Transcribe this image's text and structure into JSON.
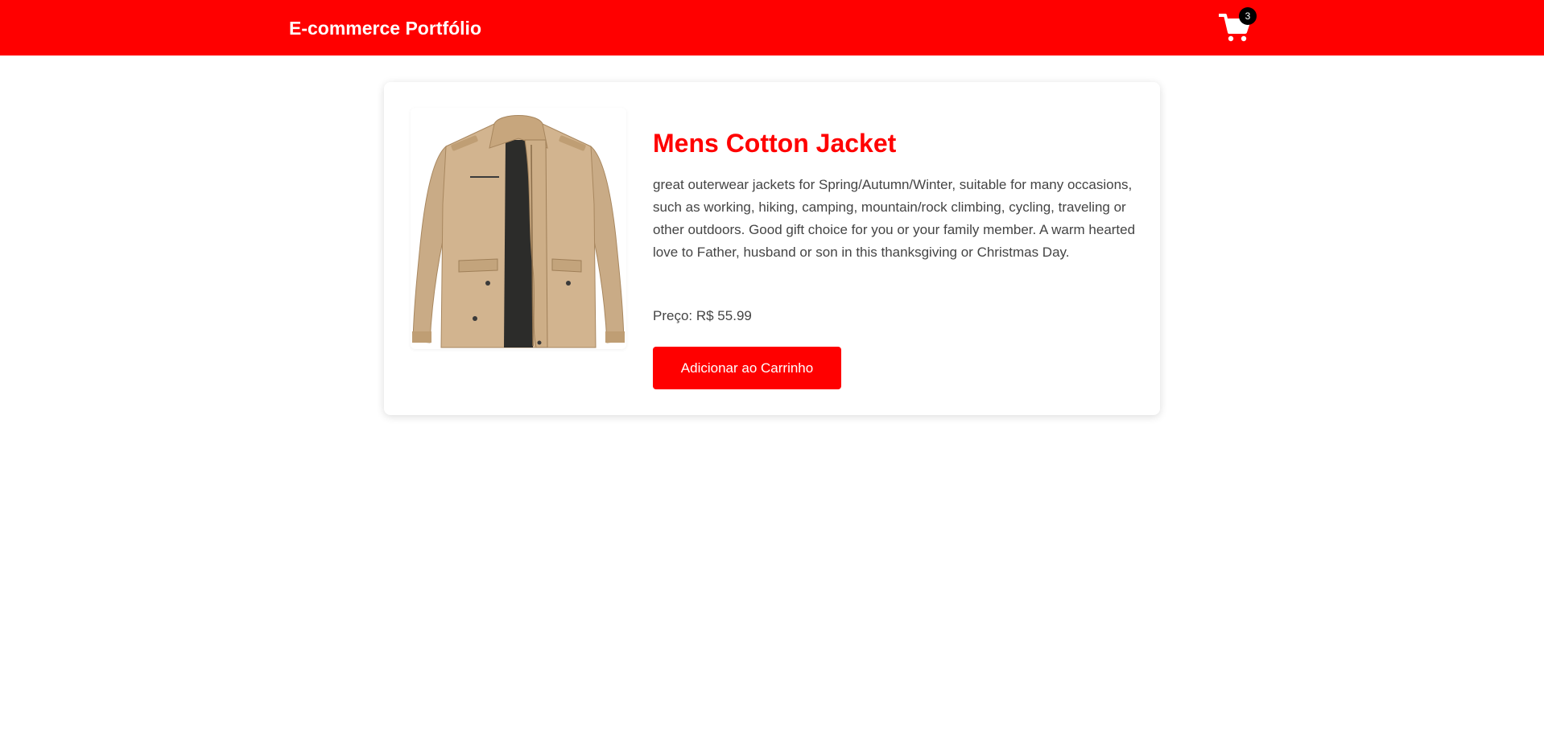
{
  "header": {
    "brand": "E-commerce Portfólio",
    "cart_icon": "shopping-cart-icon",
    "cart_count": "3",
    "background_color": "#ff0000",
    "badge_color": "#000000"
  },
  "product": {
    "image_icon": "jacket-image",
    "title": "Mens Cotton Jacket",
    "description": "great outerwear jackets for Spring/Autumn/Winter, suitable for many occasions, such as working, hiking, camping, mountain/rock climbing, cycling, traveling or other outdoors. Good gift choice for you or your family member. A warm hearted love to Father, husband or son in this thanksgiving or Christmas Day.",
    "price_label": "Preço: R$ 55.99",
    "add_button_label": "Adicionar ao Carrinho",
    "accent_color": "#ff0000"
  }
}
